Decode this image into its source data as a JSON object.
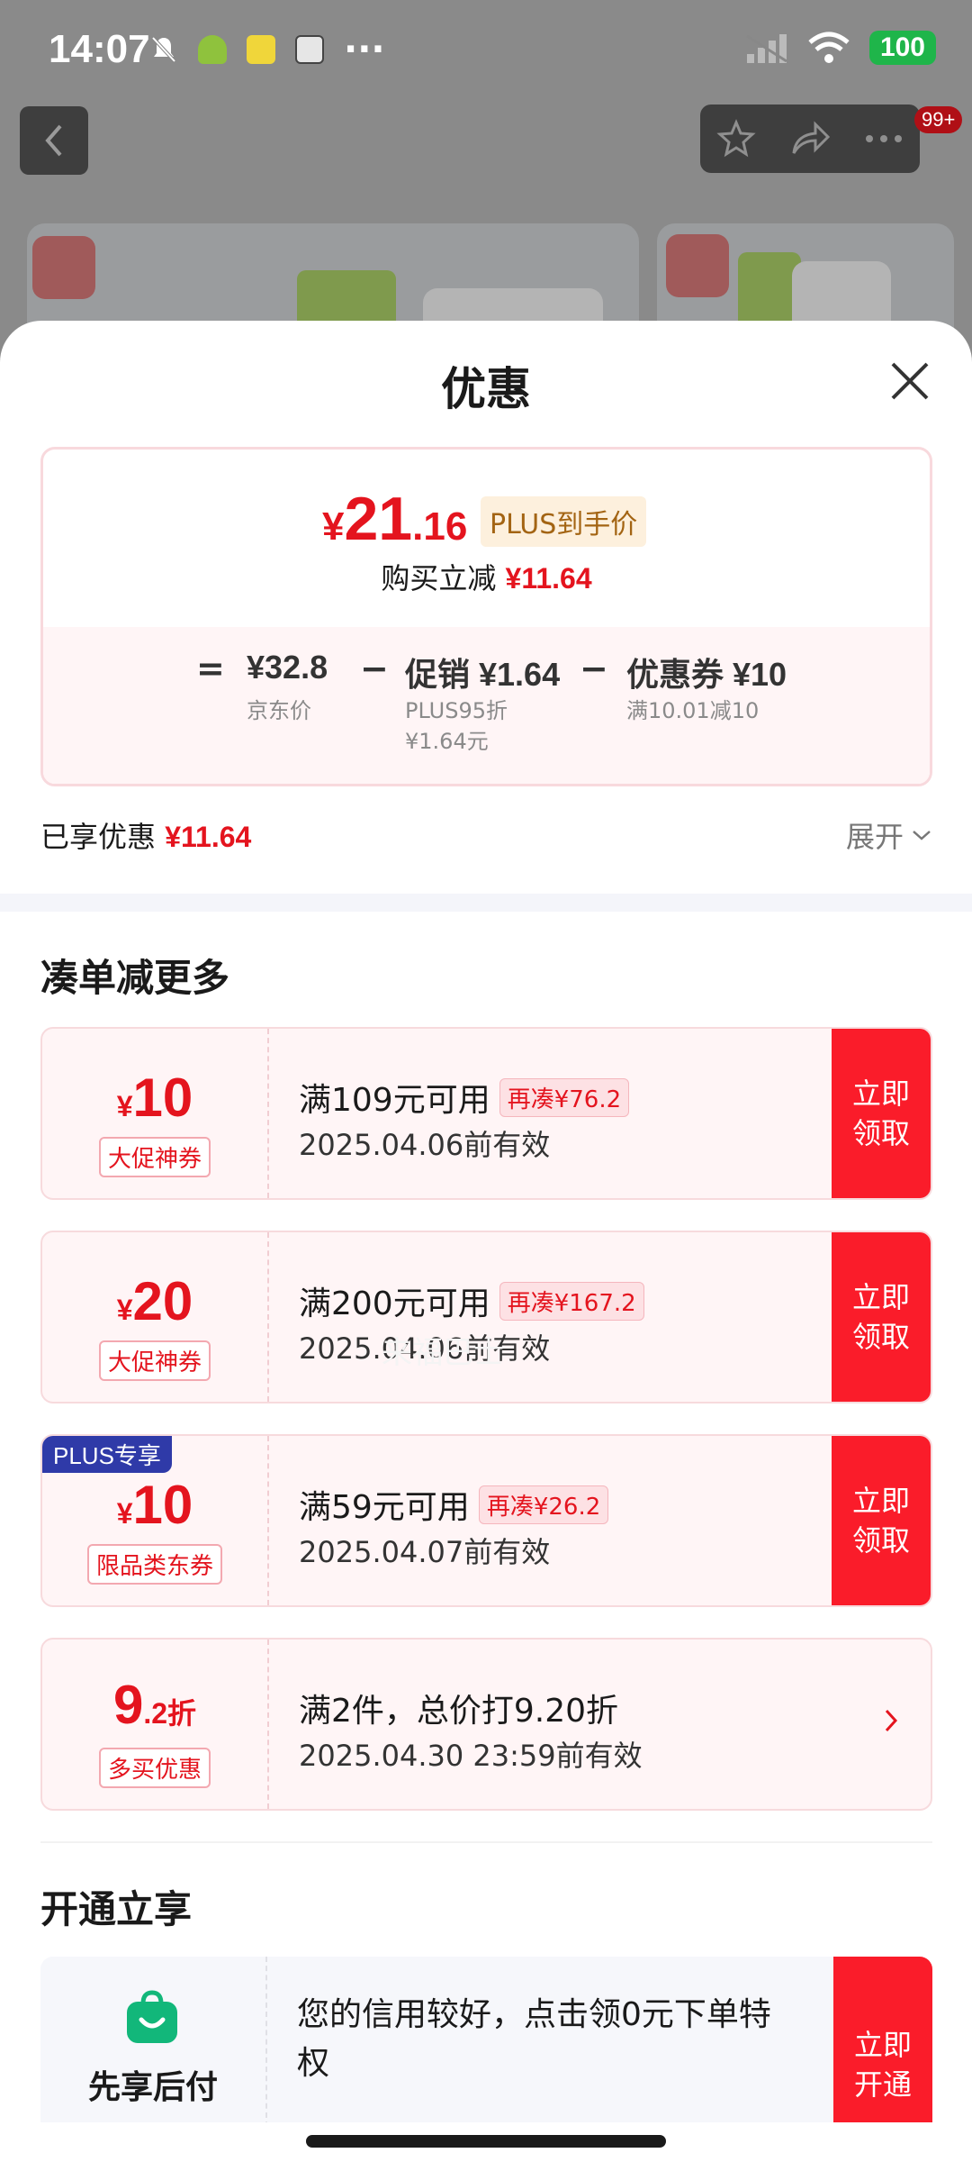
{
  "status_bar": {
    "time": "14:07",
    "battery": "100"
  },
  "top_bar": {
    "badge": "99+"
  },
  "sheet": {
    "title": "优惠",
    "price_box": {
      "currency": "¥",
      "final_int": "21",
      "final_dec": ".16",
      "plus_badge": "PLUS到手价",
      "instant_cut_label": "购买立减",
      "instant_cut_value": "¥11.64",
      "eq": "=",
      "jd_price": "¥32.8",
      "jd_price_label": "京东价",
      "minus": "−",
      "promo": "促销 ¥1.64",
      "promo_sub1": "PLUS95折",
      "promo_sub2": "¥1.64元",
      "coupon": "优惠券 ¥10",
      "coupon_sub": "满10.01减10"
    },
    "enjoyed_label": "已享优惠",
    "enjoyed_value": "¥11.64",
    "expand_label": "展开",
    "section_more": "凑单减更多",
    "watermark": "来福巴士",
    "coupons": [
      {
        "symbol": "¥",
        "amount": "10",
        "tag": "大促神券",
        "condition": "满109元可用",
        "pill": "再凑¥76.2",
        "valid": "2025.04.06前有效",
        "button": "立即领取"
      },
      {
        "symbol": "¥",
        "amount": "20",
        "tag": "大促神券",
        "condition": "满200元可用",
        "pill": "再凑¥167.2",
        "valid": "2025.04.06前有效",
        "button": "立即领取"
      },
      {
        "plus_tag": "PLUS专享",
        "symbol": "¥",
        "amount": "10",
        "tag": "限品类东券",
        "condition": "满59元可用",
        "pill": "再凑¥26.2",
        "valid": "2025.04.07前有效",
        "button": "立即领取"
      }
    ],
    "discount": {
      "big": "9",
      "small": ".2折",
      "tag": "多买优惠",
      "condition": "满2件，总价打9.20折",
      "valid": "2025.04.30 23:59前有效"
    },
    "section_open": "开通立享",
    "paylater": {
      "label": "先享后付",
      "text": "您的信用较好，点击领0元下单特权",
      "button": "立即开通"
    }
  },
  "colors": {
    "accent": "#fa1c2a",
    "price_red": "#e4141e",
    "plus_gold": "#a36413",
    "plus_blue": "#2f3aa8"
  }
}
